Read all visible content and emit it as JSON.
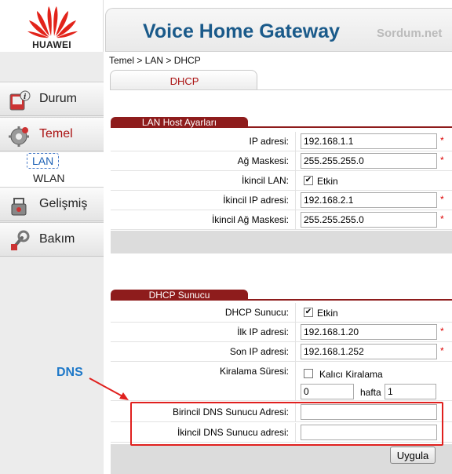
{
  "brand": {
    "logo_text": "HUAWEI",
    "logo_color": "#e2231a"
  },
  "header": {
    "title": "Voice Home Gateway",
    "watermark": "Sordum.net",
    "title_color": "#1a5a8a"
  },
  "breadcrumb": "Temel > LAN > DHCP",
  "tabs": [
    {
      "label": "DHCP",
      "active": true
    }
  ],
  "sidebar": {
    "items": [
      {
        "label": "Durum",
        "icon": "status-icon"
      },
      {
        "label": "Temel",
        "icon": "gear-icon",
        "active": true
      },
      {
        "label": "Gelişmiş",
        "icon": "advanced-tools-icon"
      },
      {
        "label": "Bakım",
        "icon": "maintenance-icon"
      }
    ],
    "subitems": [
      {
        "label": "LAN",
        "active": true
      },
      {
        "label": "WLAN"
      }
    ]
  },
  "lan_host": {
    "title": "LAN Host Ayarları",
    "ip_label": "IP adresi:",
    "ip_value": "192.168.1.1",
    "mask_label": "Ağ Maskesi:",
    "mask_value": "255.255.255.0",
    "secondary_lan_label": "İkincil LAN:",
    "secondary_lan_checked": true,
    "secondary_lan_option": "Etkin",
    "secondary_ip_label": "İkincil IP adresi:",
    "secondary_ip_value": "192.168.2.1",
    "secondary_mask_label": "İkincil Ağ Maskesi:",
    "secondary_mask_value": "255.255.255.0"
  },
  "dhcp_server": {
    "title": "DHCP Sunucu",
    "server_label": "DHCP Sunucu:",
    "server_checked": true,
    "server_option": "Etkin",
    "start_ip_label": "İlk IP adresi:",
    "start_ip_value": "192.168.1.20",
    "end_ip_label": "Son IP adresi:",
    "end_ip_value": "192.168.1.252",
    "lease_label": "Kiralama Süresi:",
    "lease_permanent_checked": false,
    "lease_permanent_option": "Kalıcı Kiralama",
    "lease_days_value": "0",
    "lease_unit": "hafta",
    "lease_weeks_value": "1",
    "primary_dns_label": "Birincil DNS Sunucu Adresi:",
    "primary_dns_value": "",
    "secondary_dns_label": "İkincil DNS Sunucu adresi:",
    "secondary_dns_value": ""
  },
  "required_mark": "*",
  "annotation": {
    "label": "DNS",
    "color": "#1e78c8",
    "highlight_color": "#e0201e"
  },
  "apply_label": "Uygula"
}
